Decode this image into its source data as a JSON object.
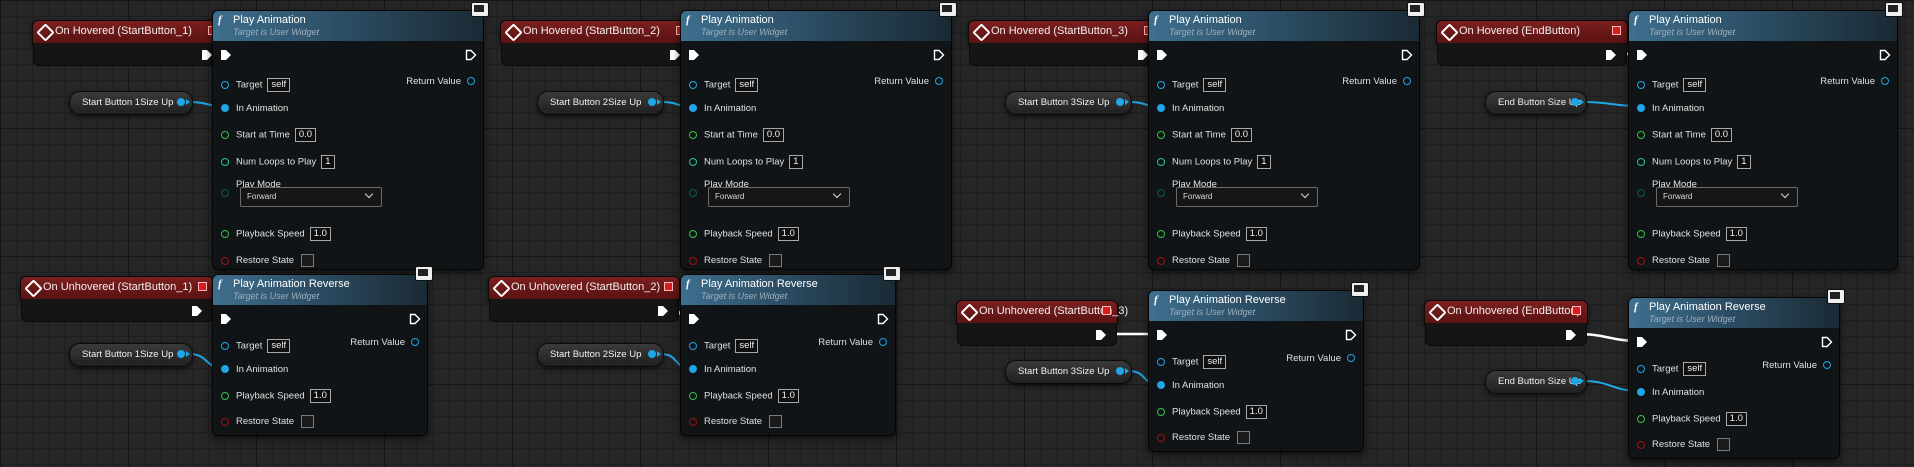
{
  "colors": {
    "canvas": "#262626",
    "event_header": "#7c1f1f",
    "function_header": "#3e6f8e",
    "exec_wire": "#ffffff",
    "object_wire": "#1ea6e6",
    "float_pin": "#3cc24a",
    "bool_pin": "#a01010"
  },
  "groups": [
    {
      "hover_event": "On Hovered (StartButton_1)",
      "unhover_event": "On Unhovered (StartButton_1)",
      "variable_label": "Start Button 1Size Up"
    },
    {
      "hover_event": "On Hovered (StartButton_2)",
      "unhover_event": "On Unhovered (StartButton_2)",
      "variable_label": "Start Button 2Size Up"
    },
    {
      "hover_event": "On Hovered (StartButton_3)",
      "unhover_event": "On Unhovered (StartButton_3)",
      "variable_label": "Start Button 3Size Up"
    },
    {
      "hover_event": "On Hovered (EndButton)",
      "unhover_event": "On Unhovered (EndButton)",
      "variable_label": "End Button Size Up"
    }
  ],
  "play_animation": {
    "title": "Play Animation",
    "subtitle": "Target is User Widget",
    "target_label": "Target",
    "target_value": "self",
    "return_label": "Return Value",
    "in_animation_label": "In Animation",
    "start_time_label": "Start at Time",
    "start_time_value": "0.0",
    "num_loops_label": "Num Loops to Play",
    "num_loops_value": "1",
    "play_mode_label": "Play Mode",
    "play_mode_value": "Forward",
    "playback_speed_label": "Playback Speed",
    "playback_speed_value": "1.0",
    "restore_state_label": "Restore State"
  },
  "play_animation_reverse": {
    "title": "Play Animation Reverse",
    "subtitle": "Target is User Widget",
    "target_label": "Target",
    "target_value": "self",
    "return_label": "Return Value",
    "in_animation_label": "In Animation",
    "playback_speed_label": "Playback Speed",
    "playback_speed_value": "1.0",
    "restore_state_label": "Restore State"
  },
  "function_icon": "f"
}
